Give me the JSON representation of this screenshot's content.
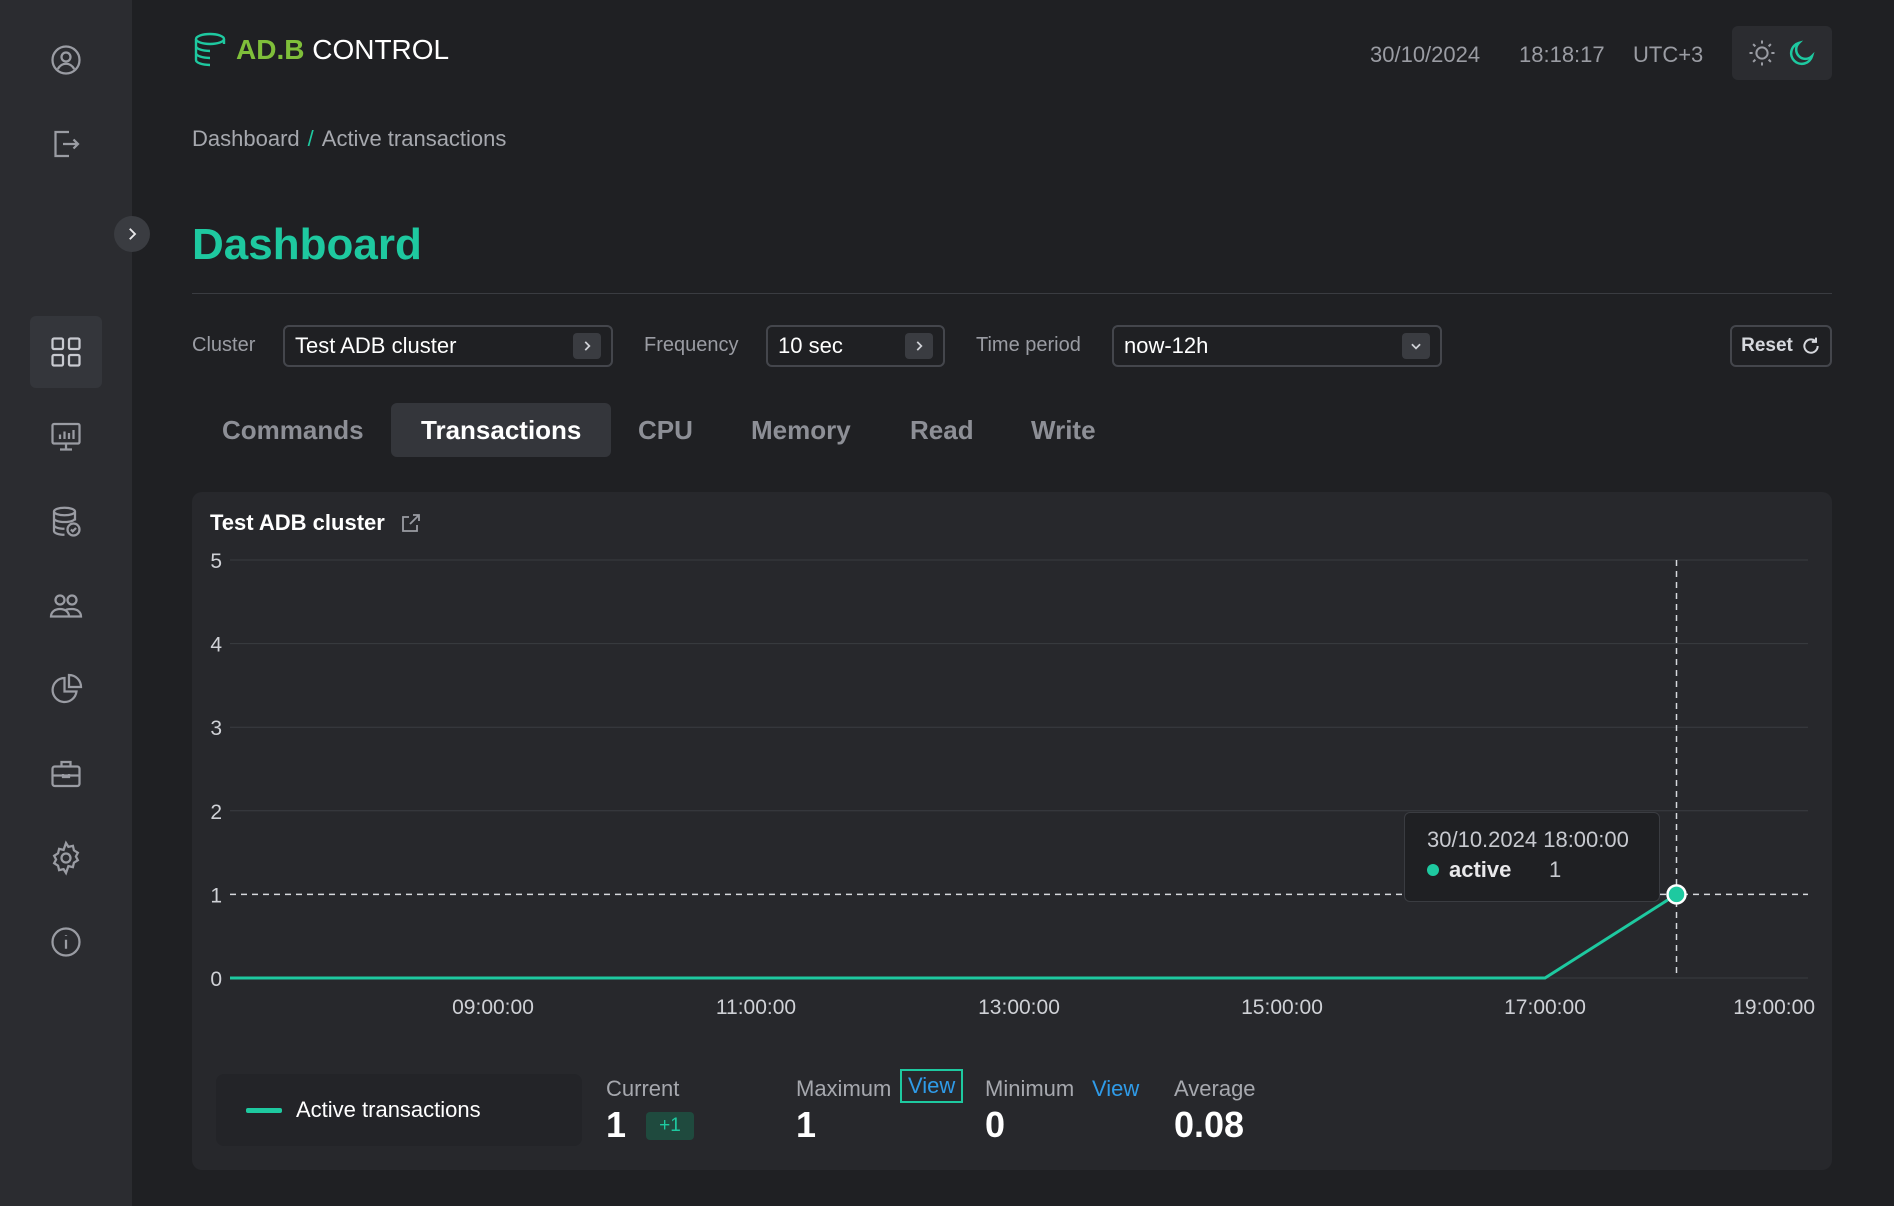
{
  "app": {
    "logo_prefix": "AD.B",
    "logo_suffix": " CONTROL"
  },
  "header": {
    "date": "30/10/2024",
    "time": "18:18:17",
    "timezone": "UTC+3"
  },
  "breadcrumb": {
    "home": "Dashboard",
    "separator": "/",
    "current": "Active transactions"
  },
  "page": {
    "title": "Dashboard"
  },
  "filters": {
    "cluster_label": "Cluster",
    "cluster_value": "Test ADB cluster",
    "frequency_label": "Frequency",
    "frequency_value": "10 sec",
    "period_label": "Time period",
    "period_value": "now-12h",
    "reset_label": "Reset"
  },
  "tabs": [
    {
      "label": "Commands",
      "active": false
    },
    {
      "label": "Transactions",
      "active": true
    },
    {
      "label": "CPU",
      "active": false
    },
    {
      "label": "Memory",
      "active": false
    },
    {
      "label": "Read",
      "active": false
    },
    {
      "label": "Write",
      "active": false
    }
  ],
  "panel": {
    "title": "Test ADB cluster"
  },
  "tooltip": {
    "date": "30/10.2024 18:00:00",
    "series": "active",
    "value": "1"
  },
  "stats": {
    "legend": "Active transactions",
    "current_label": "Current",
    "current_value": "1",
    "current_delta": "+1",
    "max_label": "Maximum",
    "max_value": "1",
    "max_view": "View",
    "min_label": "Minimum",
    "min_value": "0",
    "min_view": "View",
    "avg_label": "Average",
    "avg_value": "0.08"
  },
  "colors": {
    "accent": "#1ec9a0",
    "link": "#2f9be8",
    "background": "#1f2023",
    "sidebar": "#2b2c30"
  },
  "sidebar_icons": [
    "user-icon",
    "logout-icon",
    "dashboard-icon",
    "monitoring-icon",
    "database-icon",
    "users-icon",
    "reports-icon",
    "jobs-icon",
    "settings-icon",
    "info-icon"
  ],
  "chart_data": {
    "type": "line",
    "title": "Test ADB cluster",
    "x_ticks": [
      "09:00:00",
      "11:00:00",
      "13:00:00",
      "15:00:00",
      "17:00:00",
      "19:00:00"
    ],
    "y_ticks": [
      0,
      1,
      2,
      3,
      4,
      5
    ],
    "ylim": [
      0,
      5
    ],
    "xlim_hours": [
      7.0,
      19.0
    ],
    "series": [
      {
        "name": "Active transactions",
        "color": "#1ec9a0",
        "points": [
          {
            "x": "07:00:00",
            "y": 0
          },
          {
            "x": "17:00:00",
            "y": 0
          },
          {
            "x": "18:00:00",
            "y": 1
          }
        ]
      }
    ],
    "crosshair": {
      "x": "18:00:00",
      "y": 1
    },
    "grid": true
  }
}
